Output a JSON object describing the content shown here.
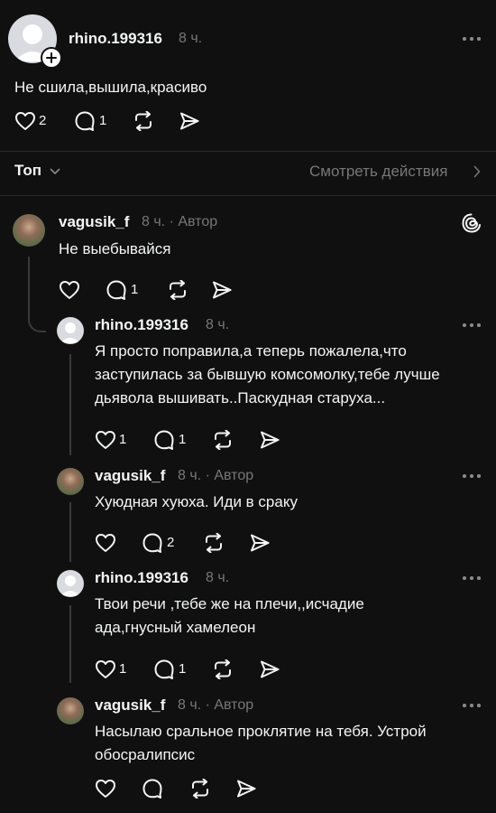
{
  "post": {
    "username": "rhino.199316",
    "time": "8 ч.",
    "text": "Не сшила,вышила,красиво",
    "likes": "2",
    "replies": "1"
  },
  "sort": {
    "label": "Топ",
    "activity_link": "Смотреть действия"
  },
  "comments": [
    {
      "username": "vagusik_f",
      "meta": "8 ч. · Автор",
      "text": "Не выебывайся",
      "likes": "",
      "replies": "1"
    },
    {
      "username": "rhino.199316",
      "meta": "8 ч.",
      "text": "Я просто поправила,а теперь пожалела,что заступилась за бывшую комсомолку,тебе лучше дьявола вышивать..Паскудная старуха...",
      "likes": "1",
      "replies": "1"
    },
    {
      "username": "vagusik_f",
      "meta": "8 ч. · Автор",
      "text": "Хуюдная хуюха. Иди в сраку",
      "likes": "",
      "replies": "2"
    },
    {
      "username": "rhino.199316",
      "meta": "8 ч.",
      "text": "Твои речи ,тебе же на плечи,,исчадие ада,гнусный хамелеон",
      "likes": "1",
      "replies": "1"
    },
    {
      "username": "vagusik_f",
      "meta": "8 ч. · Автор",
      "text": "Насылаю сральное проклятие на тебя. Устрой обосралипсис",
      "likes": "",
      "replies": ""
    }
  ],
  "icons": {
    "like": "heart-icon",
    "reply": "comment-bubble-icon",
    "repost": "repost-icon",
    "share": "send-icon",
    "more": "more-horizontal-icon",
    "threads": "threads-logo-icon",
    "follow": "plus-icon"
  }
}
